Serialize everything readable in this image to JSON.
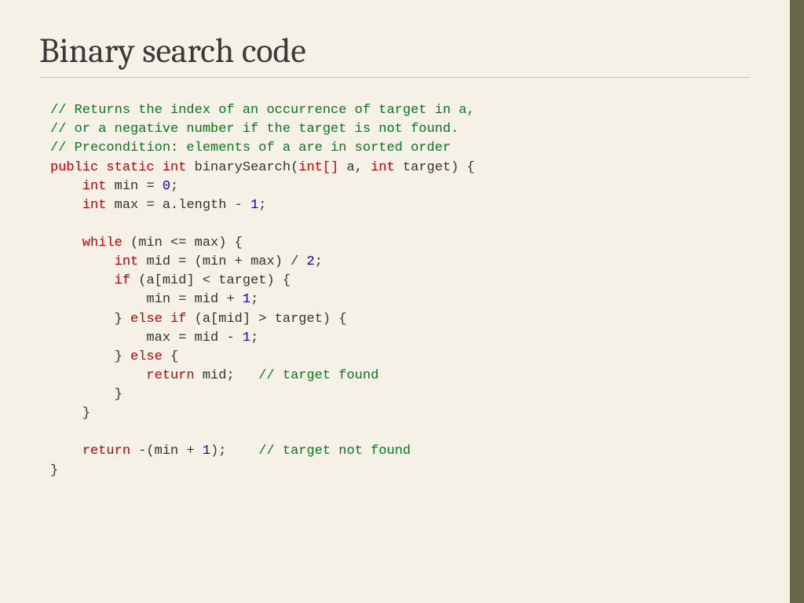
{
  "title": "Binary search code",
  "code": {
    "comment1": "// Returns the index of an occurrence of target in a,",
    "comment2": "// or a negative number if the target is not found.",
    "comment3": "// Precondition: elements of a are in sorted order",
    "kw_public": "public",
    "kw_static": "static",
    "kw_int": "int",
    "fn_name": "binarySearch",
    "sig_open": "(",
    "sig_arr": "int[]",
    "param_a": "a",
    "comma": ",",
    "param_target": "target",
    "sig_close": ")",
    "brace_open": "{",
    "brace_close": "}",
    "var_min": "min",
    "eq": "=",
    "zero": "0",
    "semi": ";",
    "var_max": "max",
    "a_len": "a.length",
    "minus": "-",
    "one": "1",
    "kw_while": "while",
    "paren_open": "(",
    "paren_close": ")",
    "le": "<=",
    "var_mid": "mid",
    "plus": "+",
    "div2": "/",
    "two": "2",
    "kw_if": "if",
    "a_mid": "a[mid]",
    "lt": "<",
    "kw_else": "else",
    "gt": ">",
    "kw_return": "return",
    "cm_found": "// target found",
    "neg_open": "-(",
    "neg_close": ")",
    "cm_notfound": "// target not found"
  }
}
